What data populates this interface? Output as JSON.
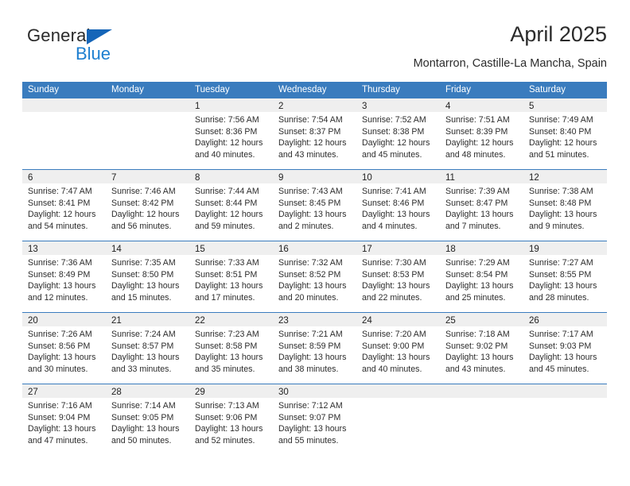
{
  "brand": {
    "name_part1": "General",
    "name_part2": "Blue",
    "triangle_color": "#1565b8",
    "blue_text_color": "#1d7fd0"
  },
  "header": {
    "title": "April 2025",
    "subtitle": "Montarron, Castille-La Mancha, Spain"
  },
  "theme": {
    "header_row_bg": "#3a7cbe",
    "day_band_bg": "#efefef",
    "row_divider": "#3a7cbe",
    "text": "#2c2c2c"
  },
  "weekdays": [
    "Sunday",
    "Monday",
    "Tuesday",
    "Wednesday",
    "Thursday",
    "Friday",
    "Saturday"
  ],
  "weeks": [
    [
      {
        "day": "",
        "sunrise": "",
        "sunset": "",
        "daylight1": "",
        "daylight2": ""
      },
      {
        "day": "",
        "sunrise": "",
        "sunset": "",
        "daylight1": "",
        "daylight2": ""
      },
      {
        "day": "1",
        "sunrise": "Sunrise: 7:56 AM",
        "sunset": "Sunset: 8:36 PM",
        "daylight1": "Daylight: 12 hours",
        "daylight2": "and 40 minutes."
      },
      {
        "day": "2",
        "sunrise": "Sunrise: 7:54 AM",
        "sunset": "Sunset: 8:37 PM",
        "daylight1": "Daylight: 12 hours",
        "daylight2": "and 43 minutes."
      },
      {
        "day": "3",
        "sunrise": "Sunrise: 7:52 AM",
        "sunset": "Sunset: 8:38 PM",
        "daylight1": "Daylight: 12 hours",
        "daylight2": "and 45 minutes."
      },
      {
        "day": "4",
        "sunrise": "Sunrise: 7:51 AM",
        "sunset": "Sunset: 8:39 PM",
        "daylight1": "Daylight: 12 hours",
        "daylight2": "and 48 minutes."
      },
      {
        "day": "5",
        "sunrise": "Sunrise: 7:49 AM",
        "sunset": "Sunset: 8:40 PM",
        "daylight1": "Daylight: 12 hours",
        "daylight2": "and 51 minutes."
      }
    ],
    [
      {
        "day": "6",
        "sunrise": "Sunrise: 7:47 AM",
        "sunset": "Sunset: 8:41 PM",
        "daylight1": "Daylight: 12 hours",
        "daylight2": "and 54 minutes."
      },
      {
        "day": "7",
        "sunrise": "Sunrise: 7:46 AM",
        "sunset": "Sunset: 8:42 PM",
        "daylight1": "Daylight: 12 hours",
        "daylight2": "and 56 minutes."
      },
      {
        "day": "8",
        "sunrise": "Sunrise: 7:44 AM",
        "sunset": "Sunset: 8:44 PM",
        "daylight1": "Daylight: 12 hours",
        "daylight2": "and 59 minutes."
      },
      {
        "day": "9",
        "sunrise": "Sunrise: 7:43 AM",
        "sunset": "Sunset: 8:45 PM",
        "daylight1": "Daylight: 13 hours",
        "daylight2": "and 2 minutes."
      },
      {
        "day": "10",
        "sunrise": "Sunrise: 7:41 AM",
        "sunset": "Sunset: 8:46 PM",
        "daylight1": "Daylight: 13 hours",
        "daylight2": "and 4 minutes."
      },
      {
        "day": "11",
        "sunrise": "Sunrise: 7:39 AM",
        "sunset": "Sunset: 8:47 PM",
        "daylight1": "Daylight: 13 hours",
        "daylight2": "and 7 minutes."
      },
      {
        "day": "12",
        "sunrise": "Sunrise: 7:38 AM",
        "sunset": "Sunset: 8:48 PM",
        "daylight1": "Daylight: 13 hours",
        "daylight2": "and 9 minutes."
      }
    ],
    [
      {
        "day": "13",
        "sunrise": "Sunrise: 7:36 AM",
        "sunset": "Sunset: 8:49 PM",
        "daylight1": "Daylight: 13 hours",
        "daylight2": "and 12 minutes."
      },
      {
        "day": "14",
        "sunrise": "Sunrise: 7:35 AM",
        "sunset": "Sunset: 8:50 PM",
        "daylight1": "Daylight: 13 hours",
        "daylight2": "and 15 minutes."
      },
      {
        "day": "15",
        "sunrise": "Sunrise: 7:33 AM",
        "sunset": "Sunset: 8:51 PM",
        "daylight1": "Daylight: 13 hours",
        "daylight2": "and 17 minutes."
      },
      {
        "day": "16",
        "sunrise": "Sunrise: 7:32 AM",
        "sunset": "Sunset: 8:52 PM",
        "daylight1": "Daylight: 13 hours",
        "daylight2": "and 20 minutes."
      },
      {
        "day": "17",
        "sunrise": "Sunrise: 7:30 AM",
        "sunset": "Sunset: 8:53 PM",
        "daylight1": "Daylight: 13 hours",
        "daylight2": "and 22 minutes."
      },
      {
        "day": "18",
        "sunrise": "Sunrise: 7:29 AM",
        "sunset": "Sunset: 8:54 PM",
        "daylight1": "Daylight: 13 hours",
        "daylight2": "and 25 minutes."
      },
      {
        "day": "19",
        "sunrise": "Sunrise: 7:27 AM",
        "sunset": "Sunset: 8:55 PM",
        "daylight1": "Daylight: 13 hours",
        "daylight2": "and 28 minutes."
      }
    ],
    [
      {
        "day": "20",
        "sunrise": "Sunrise: 7:26 AM",
        "sunset": "Sunset: 8:56 PM",
        "daylight1": "Daylight: 13 hours",
        "daylight2": "and 30 minutes."
      },
      {
        "day": "21",
        "sunrise": "Sunrise: 7:24 AM",
        "sunset": "Sunset: 8:57 PM",
        "daylight1": "Daylight: 13 hours",
        "daylight2": "and 33 minutes."
      },
      {
        "day": "22",
        "sunrise": "Sunrise: 7:23 AM",
        "sunset": "Sunset: 8:58 PM",
        "daylight1": "Daylight: 13 hours",
        "daylight2": "and 35 minutes."
      },
      {
        "day": "23",
        "sunrise": "Sunrise: 7:21 AM",
        "sunset": "Sunset: 8:59 PM",
        "daylight1": "Daylight: 13 hours",
        "daylight2": "and 38 minutes."
      },
      {
        "day": "24",
        "sunrise": "Sunrise: 7:20 AM",
        "sunset": "Sunset: 9:00 PM",
        "daylight1": "Daylight: 13 hours",
        "daylight2": "and 40 minutes."
      },
      {
        "day": "25",
        "sunrise": "Sunrise: 7:18 AM",
        "sunset": "Sunset: 9:02 PM",
        "daylight1": "Daylight: 13 hours",
        "daylight2": "and 43 minutes."
      },
      {
        "day": "26",
        "sunrise": "Sunrise: 7:17 AM",
        "sunset": "Sunset: 9:03 PM",
        "daylight1": "Daylight: 13 hours",
        "daylight2": "and 45 minutes."
      }
    ],
    [
      {
        "day": "27",
        "sunrise": "Sunrise: 7:16 AM",
        "sunset": "Sunset: 9:04 PM",
        "daylight1": "Daylight: 13 hours",
        "daylight2": "and 47 minutes."
      },
      {
        "day": "28",
        "sunrise": "Sunrise: 7:14 AM",
        "sunset": "Sunset: 9:05 PM",
        "daylight1": "Daylight: 13 hours",
        "daylight2": "and 50 minutes."
      },
      {
        "day": "29",
        "sunrise": "Sunrise: 7:13 AM",
        "sunset": "Sunset: 9:06 PM",
        "daylight1": "Daylight: 13 hours",
        "daylight2": "and 52 minutes."
      },
      {
        "day": "30",
        "sunrise": "Sunrise: 7:12 AM",
        "sunset": "Sunset: 9:07 PM",
        "daylight1": "Daylight: 13 hours",
        "daylight2": "and 55 minutes."
      },
      {
        "day": "",
        "sunrise": "",
        "sunset": "",
        "daylight1": "",
        "daylight2": ""
      },
      {
        "day": "",
        "sunrise": "",
        "sunset": "",
        "daylight1": "",
        "daylight2": ""
      },
      {
        "day": "",
        "sunrise": "",
        "sunset": "",
        "daylight1": "",
        "daylight2": ""
      }
    ]
  ]
}
